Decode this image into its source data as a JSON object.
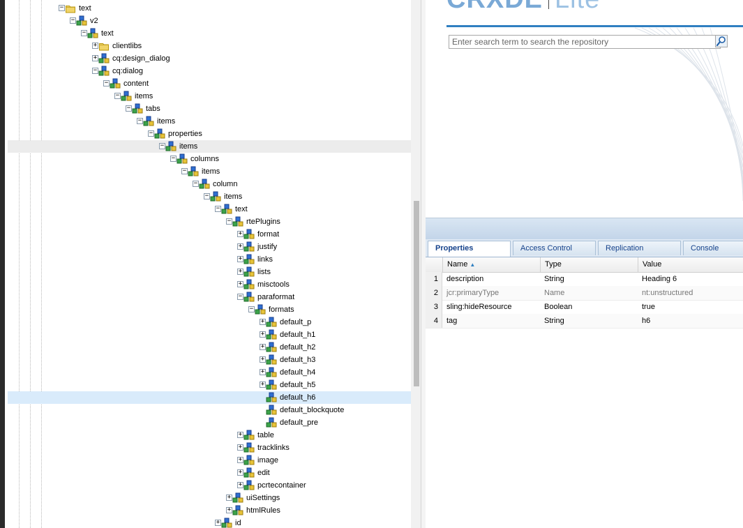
{
  "tree": {
    "nodes": [
      {
        "label": "text",
        "level": 0,
        "toggle": "-",
        "icon": "folder"
      },
      {
        "label": "v2",
        "level": 1,
        "toggle": "-",
        "icon": "node"
      },
      {
        "label": "text",
        "level": 2,
        "toggle": "-",
        "icon": "node"
      },
      {
        "label": "clientlibs",
        "level": 3,
        "toggle": "+",
        "icon": "folder"
      },
      {
        "label": "cq:design_dialog",
        "level": 3,
        "toggle": "+",
        "icon": "node"
      },
      {
        "label": "cq:dialog",
        "level": 3,
        "toggle": "-",
        "icon": "node"
      },
      {
        "label": "content",
        "level": 4,
        "toggle": "-",
        "icon": "node"
      },
      {
        "label": "items",
        "level": 5,
        "toggle": "-",
        "icon": "node"
      },
      {
        "label": "tabs",
        "level": 6,
        "toggle": "-",
        "icon": "node"
      },
      {
        "label": "items",
        "level": 7,
        "toggle": "-",
        "icon": "node"
      },
      {
        "label": "properties",
        "level": 8,
        "toggle": "-",
        "icon": "node"
      },
      {
        "label": "items",
        "level": 9,
        "toggle": "-",
        "icon": "node",
        "state": "hover"
      },
      {
        "label": "columns",
        "level": 10,
        "toggle": "-",
        "icon": "node"
      },
      {
        "label": "items",
        "level": 11,
        "toggle": "-",
        "icon": "node"
      },
      {
        "label": "column",
        "level": 12,
        "toggle": "-",
        "icon": "node"
      },
      {
        "label": "items",
        "level": 13,
        "toggle": "-",
        "icon": "node"
      },
      {
        "label": "text",
        "level": 14,
        "toggle": "-",
        "icon": "node"
      },
      {
        "label": "rtePlugins",
        "level": 15,
        "toggle": "-",
        "icon": "node"
      },
      {
        "label": "format",
        "level": 16,
        "toggle": "+",
        "icon": "node"
      },
      {
        "label": "justify",
        "level": 16,
        "toggle": "+",
        "icon": "node"
      },
      {
        "label": "links",
        "level": 16,
        "toggle": "+",
        "icon": "node"
      },
      {
        "label": "lists",
        "level": 16,
        "toggle": "+",
        "icon": "node"
      },
      {
        "label": "misctools",
        "level": 16,
        "toggle": "+",
        "icon": "node"
      },
      {
        "label": "paraformat",
        "level": 16,
        "toggle": "-",
        "icon": "node"
      },
      {
        "label": "formats",
        "level": 17,
        "toggle": "-",
        "icon": "node"
      },
      {
        "label": "default_p",
        "level": 18,
        "toggle": "+",
        "icon": "node"
      },
      {
        "label": "default_h1",
        "level": 18,
        "toggle": "+",
        "icon": "node"
      },
      {
        "label": "default_h2",
        "level": 18,
        "toggle": "+",
        "icon": "node"
      },
      {
        "label": "default_h3",
        "level": 18,
        "toggle": "+",
        "icon": "node"
      },
      {
        "label": "default_h4",
        "level": 18,
        "toggle": "+",
        "icon": "node"
      },
      {
        "label": "default_h5",
        "level": 18,
        "toggle": "+",
        "icon": "node"
      },
      {
        "label": "default_h6",
        "level": 18,
        "toggle": "",
        "icon": "node",
        "state": "selected"
      },
      {
        "label": "default_blockquote",
        "level": 18,
        "toggle": "",
        "icon": "node"
      },
      {
        "label": "default_pre",
        "level": 18,
        "toggle": "",
        "icon": "node"
      },
      {
        "label": "table",
        "level": 16,
        "toggle": "+",
        "icon": "node"
      },
      {
        "label": "tracklinks",
        "level": 16,
        "toggle": "+",
        "icon": "node"
      },
      {
        "label": "image",
        "level": 16,
        "toggle": "+",
        "icon": "node"
      },
      {
        "label": "edit",
        "level": 16,
        "toggle": "+",
        "icon": "node"
      },
      {
        "label": "pcrtecontainer",
        "level": 16,
        "toggle": "+",
        "icon": "node"
      },
      {
        "label": "uiSettings",
        "level": 15,
        "toggle": "+",
        "icon": "node"
      },
      {
        "label": "htmlRules",
        "level": 15,
        "toggle": "+",
        "icon": "node"
      },
      {
        "label": "id",
        "level": 14,
        "toggle": "+",
        "icon": "node"
      }
    ]
  },
  "header": {
    "logo_main": "CRXDE",
    "logo_sub": "Lite",
    "search_placeholder": "Enter search term to search the repository",
    "search_icon": "magnifier-icon"
  },
  "tabs": [
    {
      "label": "Properties",
      "active": true
    },
    {
      "label": "Access Control",
      "active": false
    },
    {
      "label": "Replication",
      "active": false
    },
    {
      "label": "Console",
      "active": false
    }
  ],
  "grid": {
    "columns": [
      {
        "label": "Name",
        "sort": "▲"
      },
      {
        "label": "Type",
        "sort": ""
      },
      {
        "label": "Value",
        "sort": ""
      }
    ],
    "rows": [
      {
        "num": "1",
        "name": "description",
        "type": "String",
        "value": "Heading 6",
        "inherited": false
      },
      {
        "num": "2",
        "name": "jcr:primaryType",
        "type": "Name",
        "value": "nt:unstructured",
        "inherited": true
      },
      {
        "num": "3",
        "name": "sling:hideResource",
        "type": "Boolean",
        "value": "true",
        "inherited": false
      },
      {
        "num": "4",
        "name": "tag",
        "type": "String",
        "value": "h6",
        "inherited": false
      }
    ]
  },
  "colors": {
    "accent": "#2f7fc1",
    "logo": "#7aa9d6",
    "selection": "#d9ebfb",
    "tab_text": "#15428b"
  }
}
